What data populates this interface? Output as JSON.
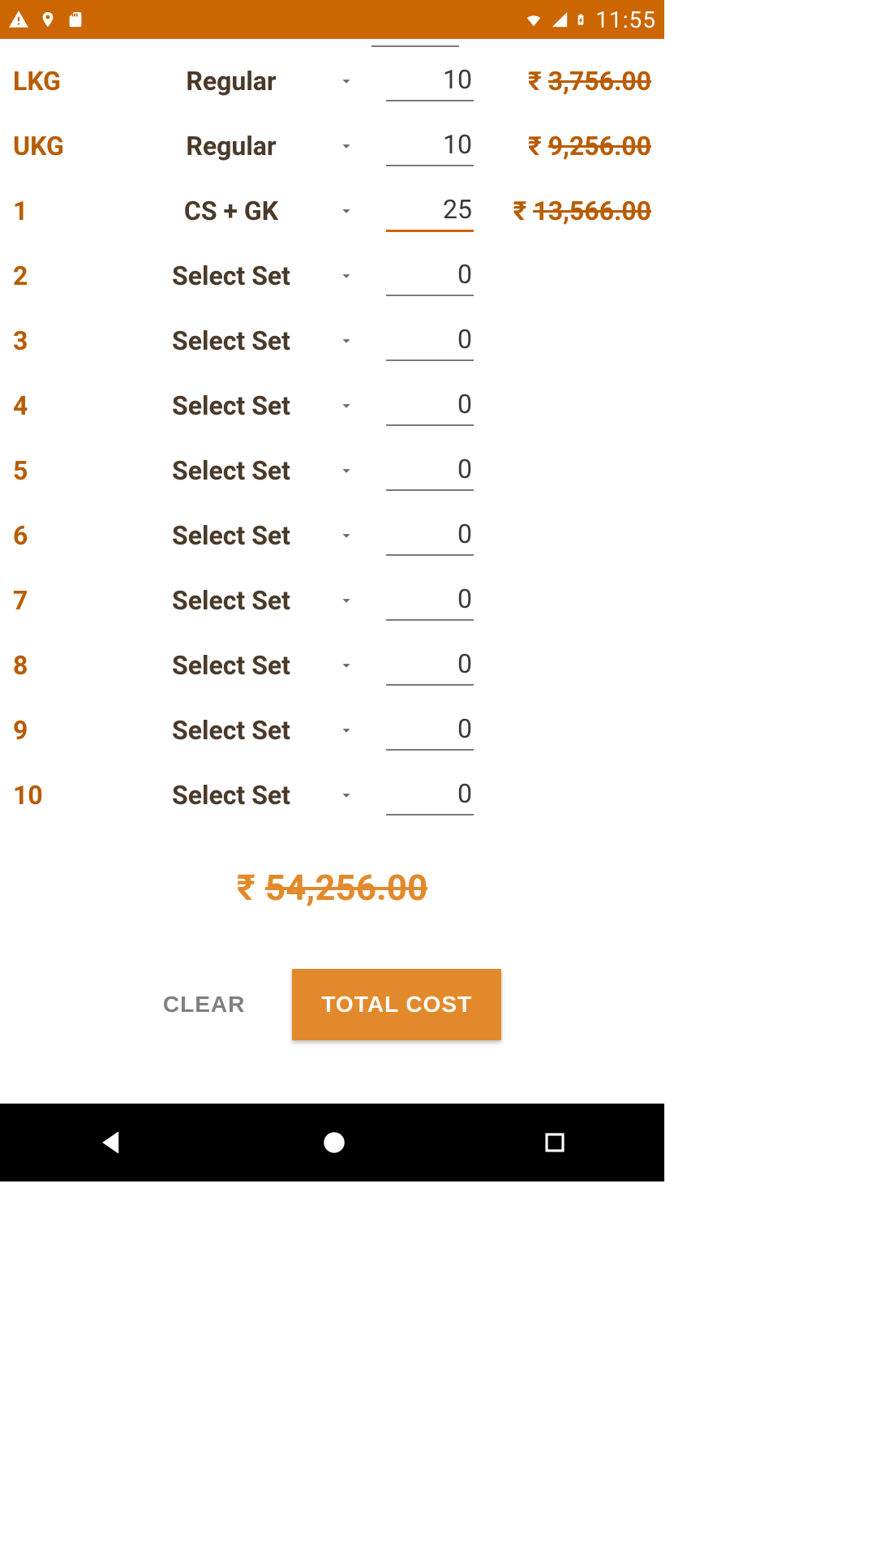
{
  "status": {
    "time": "11:55"
  },
  "rows": [
    {
      "grade": "LKG",
      "set": "Regular",
      "qty": "10",
      "active": false,
      "price_shown": true,
      "price": "3,756.00"
    },
    {
      "grade": "UKG",
      "set": "Regular",
      "qty": "10",
      "active": false,
      "price_shown": true,
      "price": "9,256.00"
    },
    {
      "grade": "1",
      "set": "CS + GK",
      "qty": "25",
      "active": true,
      "price_shown": true,
      "price": "13,566.00"
    },
    {
      "grade": "2",
      "set": "Select Set",
      "qty": "0",
      "active": false,
      "price_shown": false,
      "price": ""
    },
    {
      "grade": "3",
      "set": "Select Set",
      "qty": "0",
      "active": false,
      "price_shown": false,
      "price": ""
    },
    {
      "grade": "4",
      "set": "Select Set",
      "qty": "0",
      "active": false,
      "price_shown": false,
      "price": ""
    },
    {
      "grade": "5",
      "set": "Select Set",
      "qty": "0",
      "active": false,
      "price_shown": false,
      "price": ""
    },
    {
      "grade": "6",
      "set": "Select Set",
      "qty": "0",
      "active": false,
      "price_shown": false,
      "price": ""
    },
    {
      "grade": "7",
      "set": "Select Set",
      "qty": "0",
      "active": false,
      "price_shown": false,
      "price": ""
    },
    {
      "grade": "8",
      "set": "Select Set",
      "qty": "0",
      "active": false,
      "price_shown": false,
      "price": ""
    },
    {
      "grade": "9",
      "set": "Select Set",
      "qty": "0",
      "active": false,
      "price_shown": false,
      "price": ""
    },
    {
      "grade": "10",
      "set": "Select Set",
      "qty": "0",
      "active": false,
      "price_shown": false,
      "price": ""
    }
  ],
  "total": {
    "rupee": "₹",
    "amount": "54,256.00"
  },
  "buttons": {
    "clear": "CLEAR",
    "total_cost": "TOTAL COST"
  },
  "rupee": "₹"
}
